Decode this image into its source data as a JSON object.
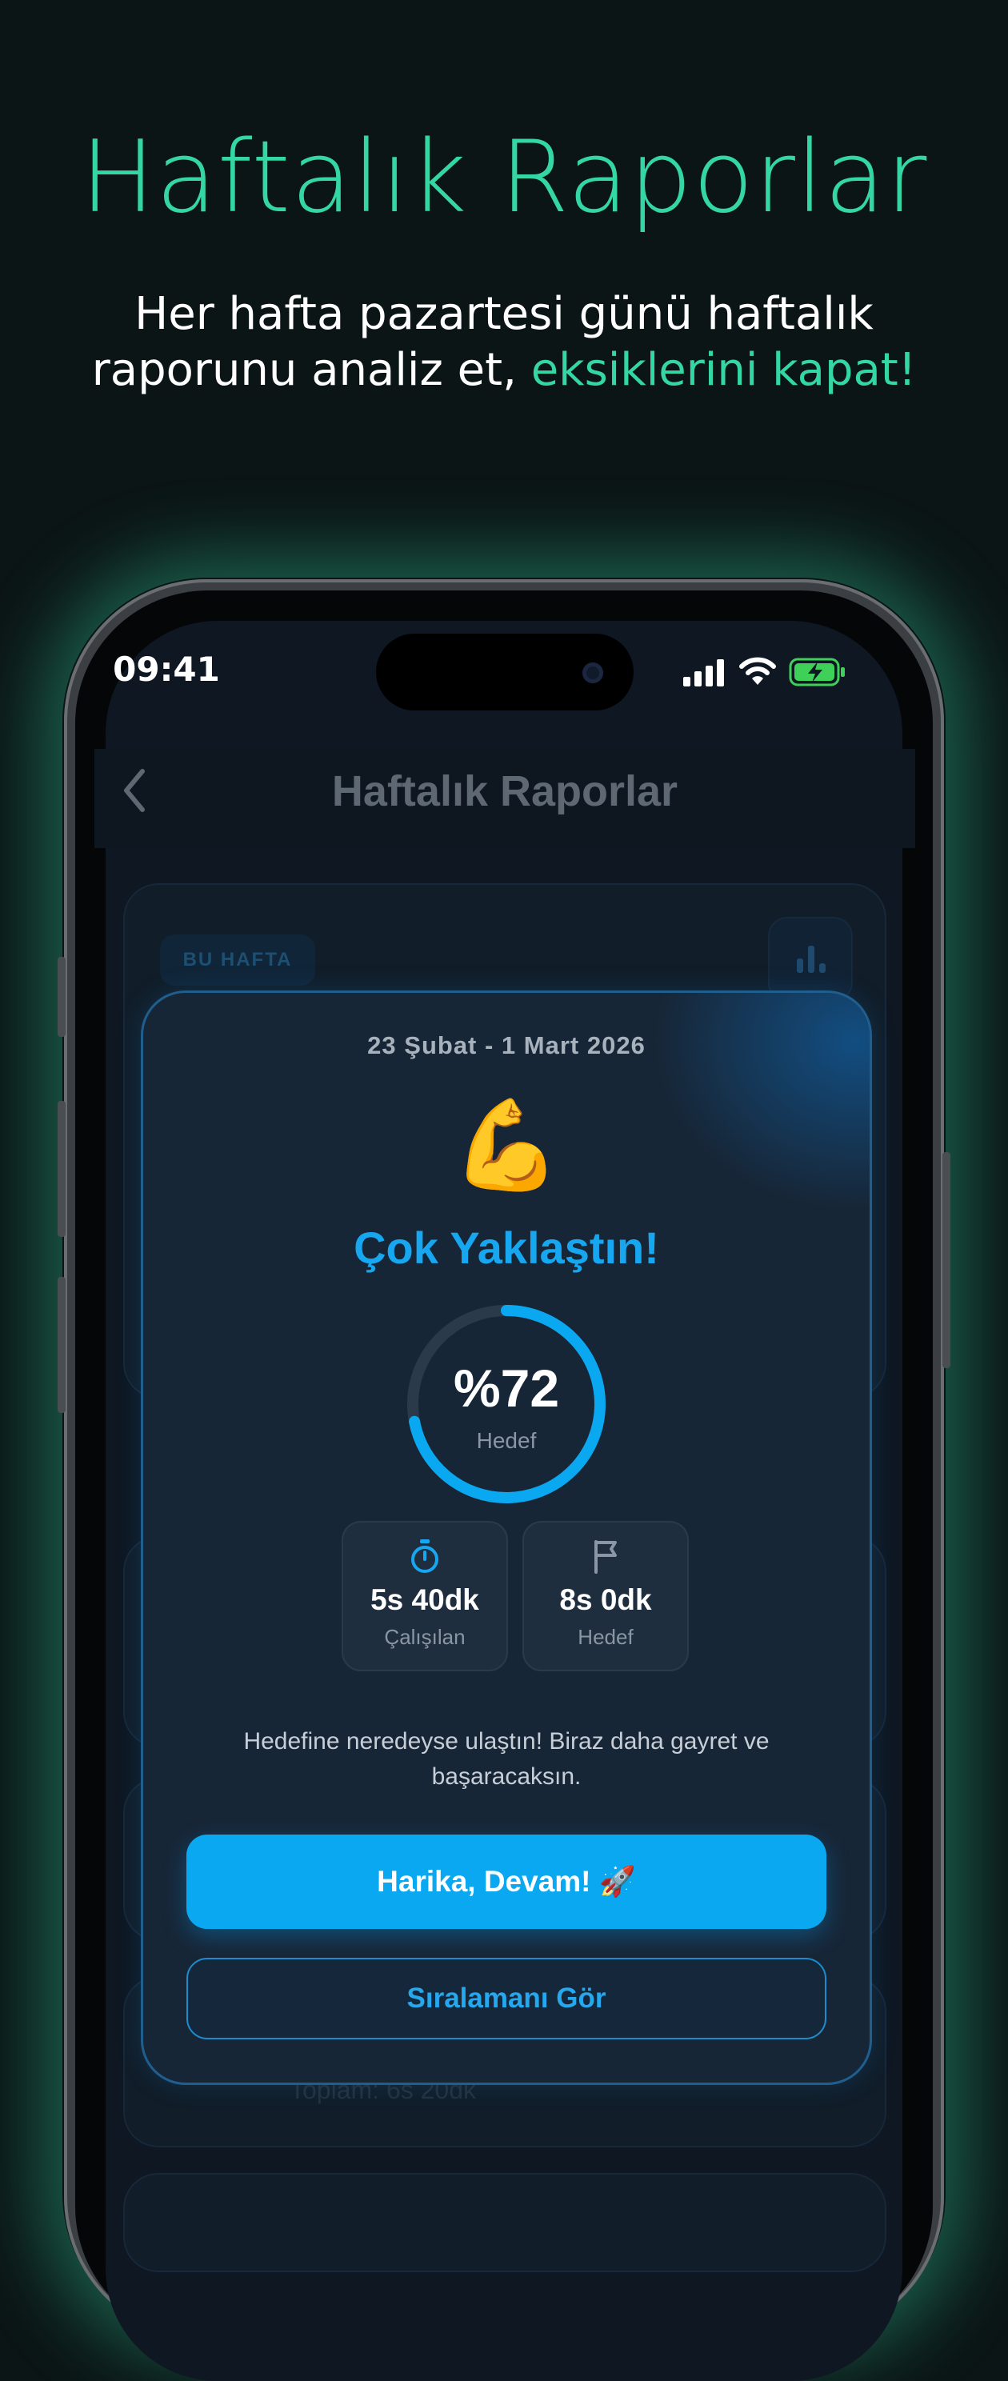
{
  "promo": {
    "headline": "Haftalık Raporlar",
    "subline_part1": "Her hafta pazartesi günü haftalık",
    "subline_part2": "raporunu analiz et,",
    "subline_accent": "eksiklerini kapat!",
    "accent_color": "#34d6a6"
  },
  "status_bar": {
    "time": "09:41",
    "icons": [
      "cellular-signal-icon",
      "wifi-icon",
      "battery-charging-icon"
    ]
  },
  "nav": {
    "title": "Haftalık Raporlar",
    "back_icon": "chevron-left-icon"
  },
  "background": {
    "badge": "BU HAFTA",
    "chart_icon": "bar-chart-icon",
    "total_text": "Toplam: 6s 20dk"
  },
  "modal": {
    "date_range": "23 Şubat - 1 Mart 2026",
    "emoji": "💪",
    "status_title": "Çok Yaklaştın!",
    "progress": {
      "value_text": "%72",
      "label": "Hedef",
      "percent": 72,
      "color": "#0aa8f0"
    },
    "stats": [
      {
        "icon": "stopwatch-icon",
        "value": "5s 40dk",
        "label": "Çalışılan"
      },
      {
        "icon": "flag-icon",
        "value": "8s 0dk",
        "label": "Hedef"
      }
    ],
    "message": "Hedefine neredeyse ulaştın! Biraz daha gayret ve başaracaksın.",
    "primary_button": "Harika, Devam! 🚀",
    "secondary_button": "Sıralamanı Gör"
  }
}
